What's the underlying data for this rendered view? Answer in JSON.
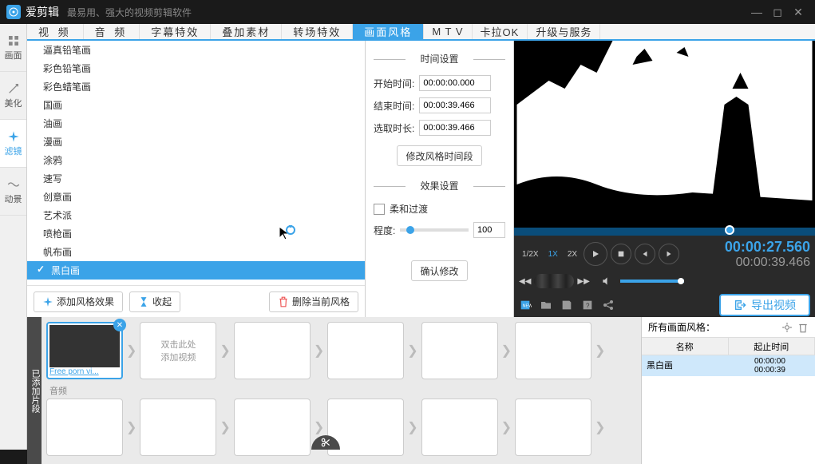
{
  "titlebar": {
    "appname": "爱剪辑",
    "tagline": "最易用、强大的视频剪辑软件"
  },
  "tabs": [
    "视  频",
    "音  频",
    "字幕特效",
    "叠加素材",
    "转场特效",
    "画面风格",
    "M T V",
    "卡拉OK",
    "升级与服务"
  ],
  "sidetabs": [
    "画面",
    "美化",
    "滤镜",
    "动景"
  ],
  "styles": [
    "逼真铅笔画",
    "彩色铅笔画",
    "彩色蜡笔画",
    "国画",
    "油画",
    "漫画",
    "涂鸦",
    "速写",
    "创意画",
    "艺术派",
    "喷枪画",
    "帆布画",
    "黑白画"
  ],
  "styleActions": {
    "add": "添加风格效果",
    "collapse": "收起",
    "delete": "删除当前风格"
  },
  "settings": {
    "timeTitle": "时间设置",
    "startLabel": "开始时间:",
    "startVal": "00:00:00.000",
    "endLabel": "结束时间:",
    "endVal": "00:00:39.466",
    "durLabel": "选取时长:",
    "durVal": "00:00:39.466",
    "modifyTime": "修改风格时间段",
    "effectTitle": "效果设置",
    "soft": "柔和过渡",
    "degree": "程度:",
    "degreeVal": "100",
    "confirm": "确认修改"
  },
  "preview": {
    "speeds": [
      "1/2X",
      "1X",
      "2X"
    ],
    "time1": "00:00:27.560",
    "time2": "00:00:39.466",
    "export": "导出视频"
  },
  "timeline": {
    "label": "已添加片段",
    "clipCaption": "Free porn vi...",
    "placeholder": "双击此处\n添加视频",
    "audio": "音频",
    "panelTitle": "所有画面风格：",
    "col1": "名称",
    "col2": "起止时间",
    "rowName": "黑白画",
    "rowStart": "00:00:00",
    "rowEnd": "00:00:39"
  }
}
